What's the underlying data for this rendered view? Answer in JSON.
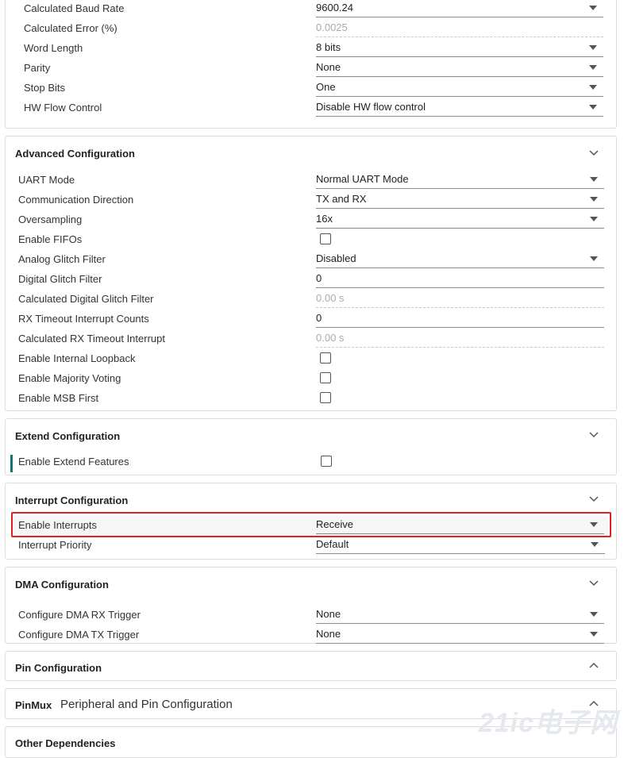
{
  "basic": {
    "rows": [
      {
        "label": "Calculated Baud Rate",
        "value": "9600.24",
        "type": "select"
      },
      {
        "label": "Calculated Error (%)",
        "value": "0.0025",
        "type": "disabled"
      },
      {
        "label": "Word Length",
        "value": "8 bits",
        "type": "select"
      },
      {
        "label": "Parity",
        "value": "None",
        "type": "select"
      },
      {
        "label": "Stop Bits",
        "value": "One",
        "type": "select"
      },
      {
        "label": "HW Flow Control",
        "value": "Disable HW flow control",
        "type": "select"
      }
    ]
  },
  "advanced": {
    "title": "Advanced Configuration",
    "rows": [
      {
        "label": "UART Mode",
        "value": "Normal UART Mode"
      },
      {
        "label": "Communication Direction",
        "value": "TX and RX"
      },
      {
        "label": "Oversampling",
        "value": "16x"
      },
      {
        "label": "Enable FIFOs"
      },
      {
        "label": "Analog Glitch Filter",
        "value": "Disabled"
      },
      {
        "label": "Digital Glitch Filter",
        "value": "0"
      },
      {
        "label": "Calculated Digital Glitch Filter",
        "value": "0.00 s"
      },
      {
        "label": "RX Timeout Interrupt Counts",
        "value": "0"
      },
      {
        "label": "Calculated RX Timeout Interrupt",
        "value": "0.00 s"
      },
      {
        "label": "Enable Internal Loopback"
      },
      {
        "label": "Enable Majority Voting"
      },
      {
        "label": "Enable MSB First"
      }
    ]
  },
  "extend": {
    "title": "Extend Configuration",
    "label": "Enable Extend Features"
  },
  "interrupt": {
    "title": "Interrupt Configuration",
    "rows": [
      {
        "label": "Enable Interrupts",
        "value": "Receive"
      },
      {
        "label": "Interrupt Priority",
        "value": "Default"
      }
    ]
  },
  "dma": {
    "title": "DMA Configuration",
    "rows": [
      {
        "label": "Configure DMA RX Trigger",
        "value": "None"
      },
      {
        "label": "Configure DMA TX Trigger",
        "value": "None"
      }
    ]
  },
  "pin": {
    "title": "Pin Configuration"
  },
  "pinmux": {
    "title": "PinMux",
    "subtitle": "Peripheral and Pin Configuration"
  },
  "other": {
    "title": "Other Dependencies"
  },
  "watermark": "21ic电子网"
}
